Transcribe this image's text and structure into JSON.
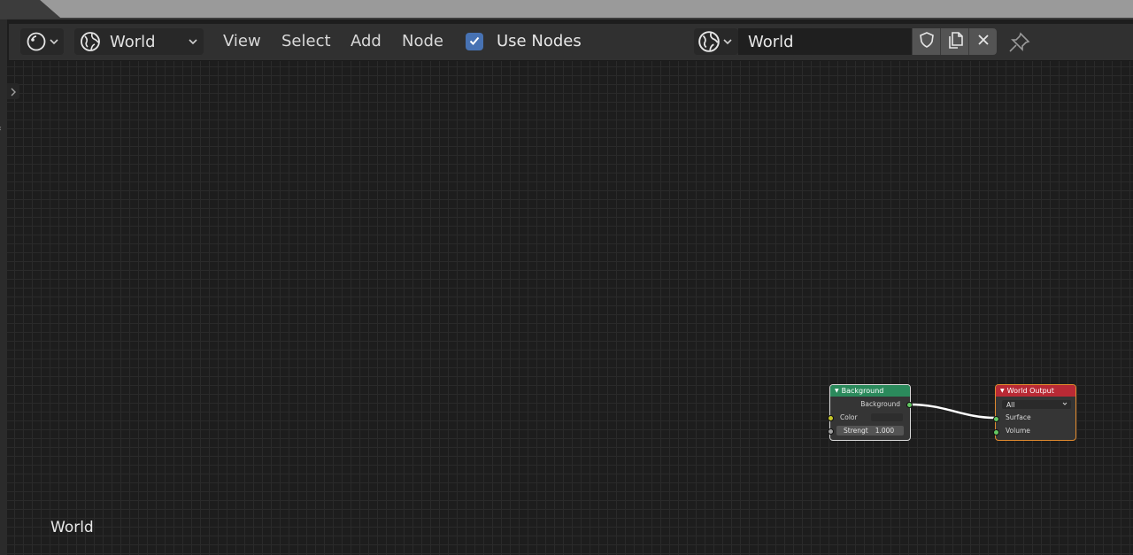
{
  "header": {
    "editor_type_icon": "node-editor-icon",
    "world_select_label": "World",
    "menu": [
      "View",
      "Select",
      "Add",
      "Node"
    ],
    "use_nodes_label": "Use Nodes",
    "use_nodes_checked": true,
    "datablock_name": "World"
  },
  "canvas": {
    "context_label": "World"
  },
  "nodes": {
    "background": {
      "title": "Background",
      "output_label": "Background",
      "color_label": "Color",
      "strength_label": "Strengt",
      "strength_value": "1.000"
    },
    "world_output": {
      "title": "World Output",
      "target_value": "All",
      "surface_label": "Surface",
      "volume_label": "Volume"
    }
  },
  "colors": {
    "accent_check": "#4772b3",
    "node_background_header": "#2b8a5c",
    "node_output_header": "#b92a35",
    "socket_shader": "#63c763",
    "socket_color": "#c7c729",
    "socket_float": "#a1a1a1"
  }
}
